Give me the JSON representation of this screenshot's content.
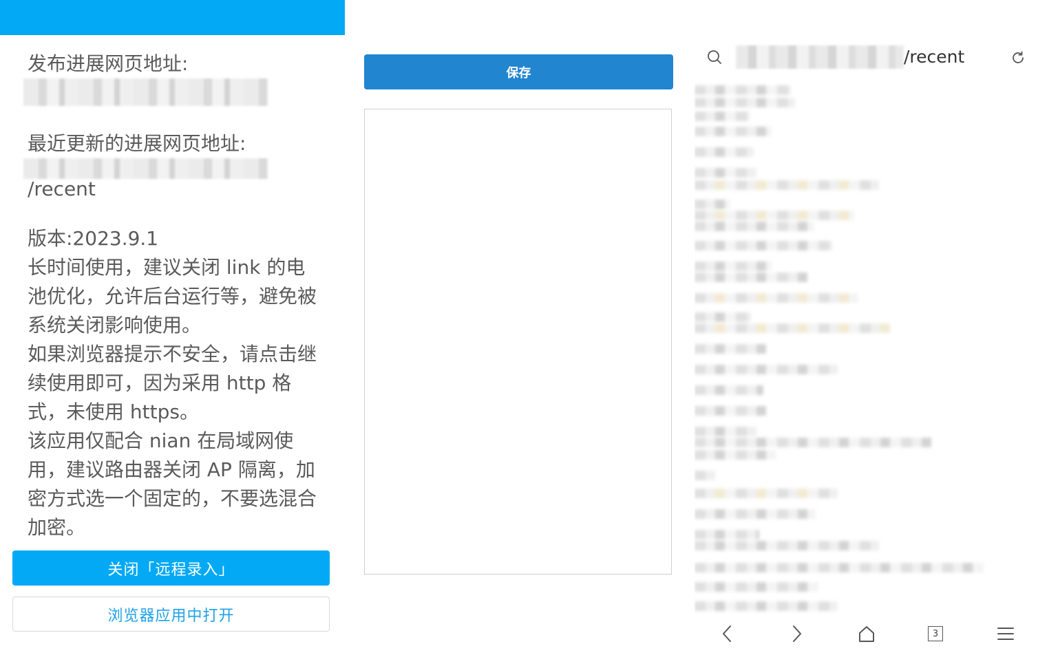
{
  "left": {
    "publish_url_label": "发布进展网页地址:",
    "recent_url_label": "最近更新的进展网页地址:",
    "recent_url_suffix": "/recent",
    "version": "版本:2023.9.1",
    "tip_battery": "长时间使用，建议关闭 link 的电池优化，允许后台运行等，避免被系统关闭影响使用。",
    "tip_unsafe": "如果浏览器提示不安全，请点击继续使用即可，因为采用 http 格式，未使用 https。",
    "tip_network": "该应用仅配合 nian 在局域网使用，建议路由器关闭 AP 隔离，加密方式选一个固定的，不要选混合加密。",
    "close_remote_button": "关闭「远程录入」",
    "open_in_browser_button": "浏览器应用中打开"
  },
  "middle": {
    "save_button": "保存",
    "textarea_value": ""
  },
  "right": {
    "address_suffix": "/recent",
    "tab_count": "3"
  },
  "colors": {
    "topbar": "#03a9f4",
    "primary_button": "#03a9f4",
    "save_button": "#2185d0",
    "link_text": "#1ea2e6"
  },
  "icons": {
    "search": "search-icon",
    "reload": "reload-icon",
    "back": "chevron-left-icon",
    "forward": "chevron-right-icon",
    "home": "home-icon",
    "tabs": "tabs-icon",
    "menu": "menu-icon"
  }
}
